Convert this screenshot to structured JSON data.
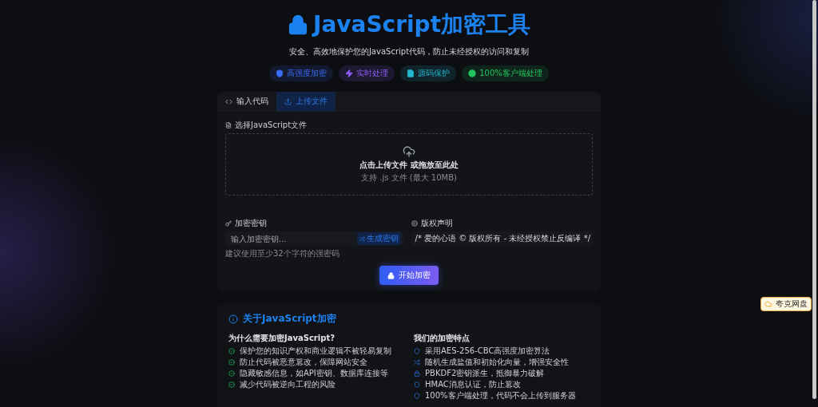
{
  "header": {
    "title": "JavaScript加密工具",
    "subtitle": "安全、高效地保护您的JavaScript代码，防止未经授权的访问和复制"
  },
  "badges": [
    {
      "kind": "shield",
      "label": "高强度加密",
      "color": "#3b6cf6"
    },
    {
      "kind": "bolt",
      "label": "实时处理",
      "color": "#8b5cf6"
    },
    {
      "kind": "file",
      "label": "源码保护",
      "color": "#22b8cf"
    },
    {
      "kind": "check",
      "label": "100%客户端处理",
      "color": "#22c55e"
    }
  ],
  "tabs": [
    {
      "kind": "code",
      "label": "输入代码",
      "selected": false
    },
    {
      "kind": "upload",
      "label": "上传文件",
      "selected": true
    }
  ],
  "upload": {
    "label": "选择JavaScript文件",
    "prompt": "点击上传文件 或拖放至此处",
    "hint": "支持 .js 文件 (最大 10MB)"
  },
  "key": {
    "label": "加密密钥",
    "placeholder": "输入加密密钥...",
    "generate": "生成密钥",
    "hint": "建议使用至少32个字符的强密码"
  },
  "copyright": {
    "label": "版权声明",
    "value": "/* 爱的心语 © 版权所有 - 未经授权禁止反编译 */"
  },
  "submit": "开始加密",
  "about": {
    "title": "关于JavaScript加密",
    "why_title": "为什么需要加密JavaScript?",
    "why": [
      "保护您的知识产权和商业逻辑不被轻易复制",
      "防止代码被恶意篡改，保障网站安全",
      "隐藏敏感信息，如API密钥、数据库连接等",
      "减少代码被逆向工程的风险"
    ],
    "features_title": "我们的加密特点",
    "features": [
      {
        "kind": "shield",
        "text": "采用AES-256-CBC高强度加密算法"
      },
      {
        "kind": "shuffle",
        "text": "随机生成盐值和初始化向量，增强安全性"
      },
      {
        "kind": "lock",
        "text": "PBKDF2密钥派生，抵御暴力破解"
      },
      {
        "kind": "shield",
        "text": "HMAC消息认证，防止篡改"
      },
      {
        "kind": "shield",
        "text": "100%客户端处理，代码不会上传到服务器"
      }
    ]
  },
  "widget": {
    "label": "夸克网盘"
  }
}
